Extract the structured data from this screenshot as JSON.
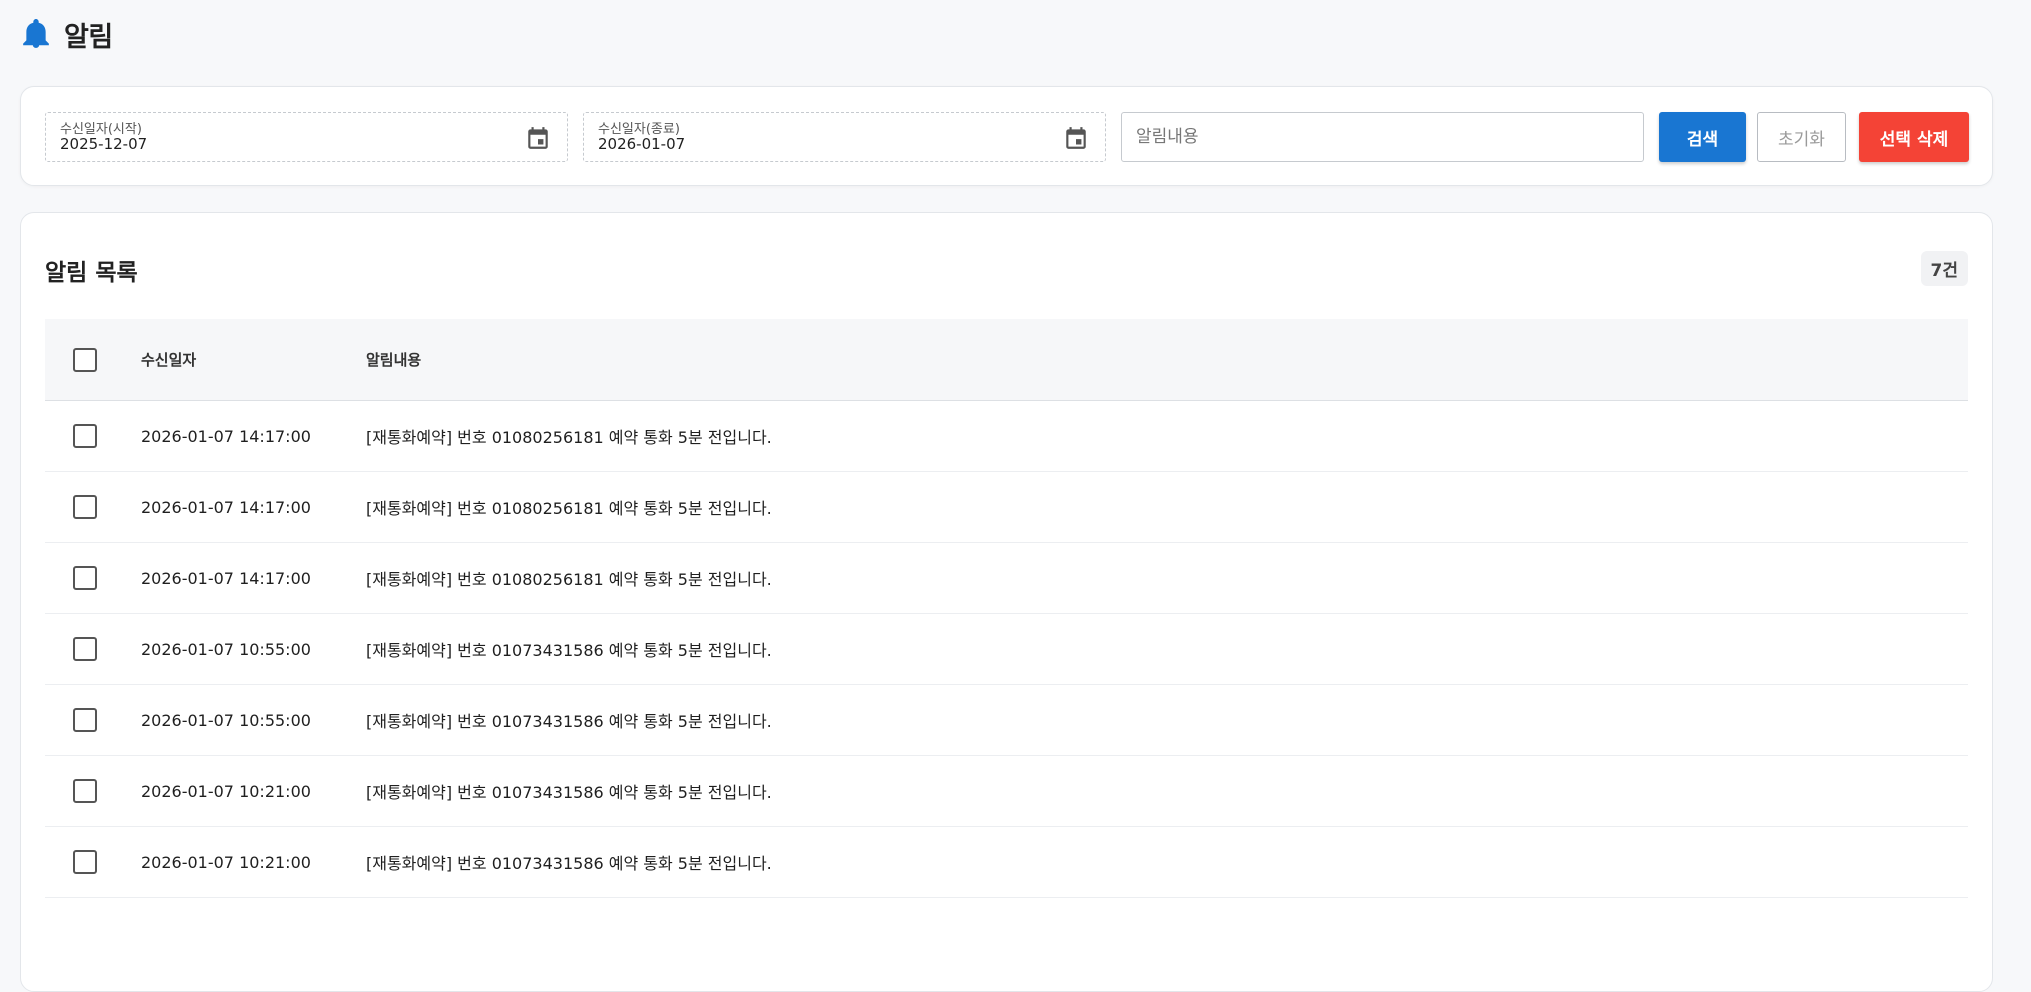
{
  "header": {
    "title": "알림",
    "icon": "bell-icon",
    "accent_color": "#1976d2"
  },
  "filters": {
    "start_date": {
      "label": "수신일자(시작)",
      "value": "2025-12-07",
      "icon": "calendar-icon"
    },
    "end_date": {
      "label": "수신일자(종료)",
      "value": "2026-01-07",
      "icon": "calendar-icon"
    },
    "content_search": {
      "placeholder": "알림내용",
      "value": ""
    },
    "search_button": "검색",
    "reset_button": "초기화",
    "delete_button": "선택 삭제",
    "search_button_color": "#1976d2",
    "delete_button_color": "#f44336"
  },
  "list": {
    "title": "알림 목록",
    "count": "7건",
    "columns": {
      "date": "수신일자",
      "content": "알림내용"
    },
    "rows": [
      {
        "date": "2026-01-07 14:17:00",
        "content": "[재통화예약] 번호 01080256181 예약 통화 5분 전입니다."
      },
      {
        "date": "2026-01-07 14:17:00",
        "content": "[재통화예약] 번호 01080256181 예약 통화 5분 전입니다."
      },
      {
        "date": "2026-01-07 14:17:00",
        "content": "[재통화예약] 번호 01080256181 예약 통화 5분 전입니다."
      },
      {
        "date": "2026-01-07 10:55:00",
        "content": "[재통화예약] 번호 01073431586 예약 통화 5분 전입니다."
      },
      {
        "date": "2026-01-07 10:55:00",
        "content": "[재통화예약] 번호 01073431586 예약 통화 5분 전입니다."
      },
      {
        "date": "2026-01-07 10:21:00",
        "content": "[재통화예약] 번호 01073431586 예약 통화 5분 전입니다."
      },
      {
        "date": "2026-01-07 10:21:00",
        "content": "[재통화예약] 번호 01073431586 예약 통화 5분 전입니다."
      }
    ]
  }
}
